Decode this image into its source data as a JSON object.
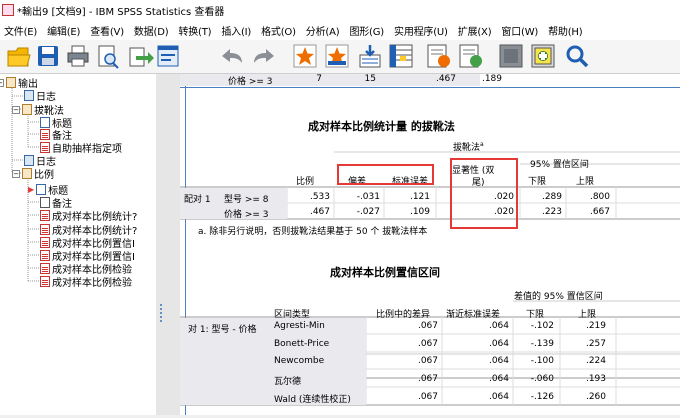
{
  "window": {
    "title": "*輸出9 [文档9] - IBM SPSS Statistics 查看器"
  },
  "menu": [
    "文件(E)",
    "编辑(E)",
    "查看(V)",
    "数据(D)",
    "转换(T)",
    "插入(I)",
    "格式(O)",
    "分析(A)",
    "图形(G)",
    "实用程序(U)",
    "扩展(X)",
    "窗口(W)",
    "帮助(H)"
  ],
  "toolbar_icons": [
    "open-folder-icon",
    "save-icon",
    "print-icon",
    "print-preview-icon",
    "export-icon",
    "recall-dialog-icon",
    "undo-icon",
    "redo-icon",
    "go-to-data-icon",
    "go-to-case-icon",
    "variables-icon",
    "insert-output-icon",
    "chart-builder-icon",
    "pivot-icon",
    "designate-window-icon",
    "zoom-icon"
  ],
  "tree": [
    {
      "label": "输出",
      "icon": "book",
      "level": 0,
      "expander": "−"
    },
    {
      "label": "日志",
      "icon": "log",
      "level": 1
    },
    {
      "label": "拔靴法",
      "icon": "book",
      "level": 1,
      "expander": "−"
    },
    {
      "label": "标题",
      "icon": "title",
      "level": 2
    },
    {
      "label": "备注",
      "icon": "tbl",
      "level": 2
    },
    {
      "label": "自助抽样指定项",
      "icon": "tbl",
      "level": 2
    },
    {
      "label": "日志",
      "icon": "log",
      "level": 1
    },
    {
      "label": "比例",
      "icon": "book",
      "level": 1,
      "expander": "−"
    },
    {
      "label": "标题",
      "icon": "title",
      "level": 2,
      "arrow": true
    },
    {
      "label": "备注",
      "icon": "note",
      "level": 2
    },
    {
      "label": "成对样本比例统计?",
      "icon": "tbl",
      "level": 2
    },
    {
      "label": "成对样本比例统计?",
      "icon": "tbl",
      "level": 2
    },
    {
      "label": "成对样本比例置信I",
      "icon": "tbl",
      "level": 2
    },
    {
      "label": "成对样本比例置信I",
      "icon": "tbl",
      "level": 2
    },
    {
      "label": "成对样本比例检验",
      "icon": "tbl",
      "level": 2
    },
    {
      "label": "成对样本比例检验",
      "icon": "tbl",
      "level": 2
    }
  ],
  "top_partial_row": {
    "label": "价格 >= 3",
    "values": [
      "7",
      "15",
      ".467",
      ".189"
    ]
  },
  "table1": {
    "title": "成对样本比例统计量 的拔靴法",
    "bootstrap_label": "拔靴法",
    "bootstrap_superscript": "a",
    "ci_header": "95% 置信区间",
    "col_headers": [
      "比例",
      "偏差",
      "标准误差",
      "显著性 (双尾)",
      "下限",
      "上限"
    ],
    "sig_line1": "显著性 (双",
    "sig_line2": "尾)",
    "row_group": "配对 1",
    "rows": [
      {
        "label": "型号 >= 8",
        "values": [
          ".533",
          "-.031",
          ".121",
          ".020",
          ".289",
          ".800"
        ]
      },
      {
        "label": "价格 >= 3",
        "values": [
          ".467",
          "-.027",
          ".109",
          ".020",
          ".223",
          ".667"
        ]
      }
    ],
    "footnote": "a. 除非另行说明，否则拔靴法结果基于 50 个 拔靴法样本"
  },
  "table2": {
    "title": "成对样本比例置信区间",
    "ci_header": "差值的 95% 置信区间",
    "col_headers": [
      "区间类型",
      "比例中的差异",
      "渐近标准误差",
      "下限",
      "上限"
    ],
    "row_group": "对 1: 型号 - 价格",
    "rows": [
      {
        "label": "Agresti-Min",
        "values": [
          ".067",
          ".064",
          "-.102",
          ".219"
        ]
      },
      {
        "label": "Bonett-Price",
        "values": [
          ".067",
          ".064",
          "-.139",
          ".257"
        ]
      },
      {
        "label": "Newcombe",
        "values": [
          ".067",
          ".064",
          "-.100",
          ".224"
        ]
      },
      {
        "label": "瓦尔德",
        "values": [
          ".067",
          ".064",
          "-.060",
          ".193"
        ]
      },
      {
        "label": "Wald (连续性校正)",
        "values": [
          ".067",
          ".064",
          "-.126",
          ".260"
        ]
      }
    ]
  }
}
